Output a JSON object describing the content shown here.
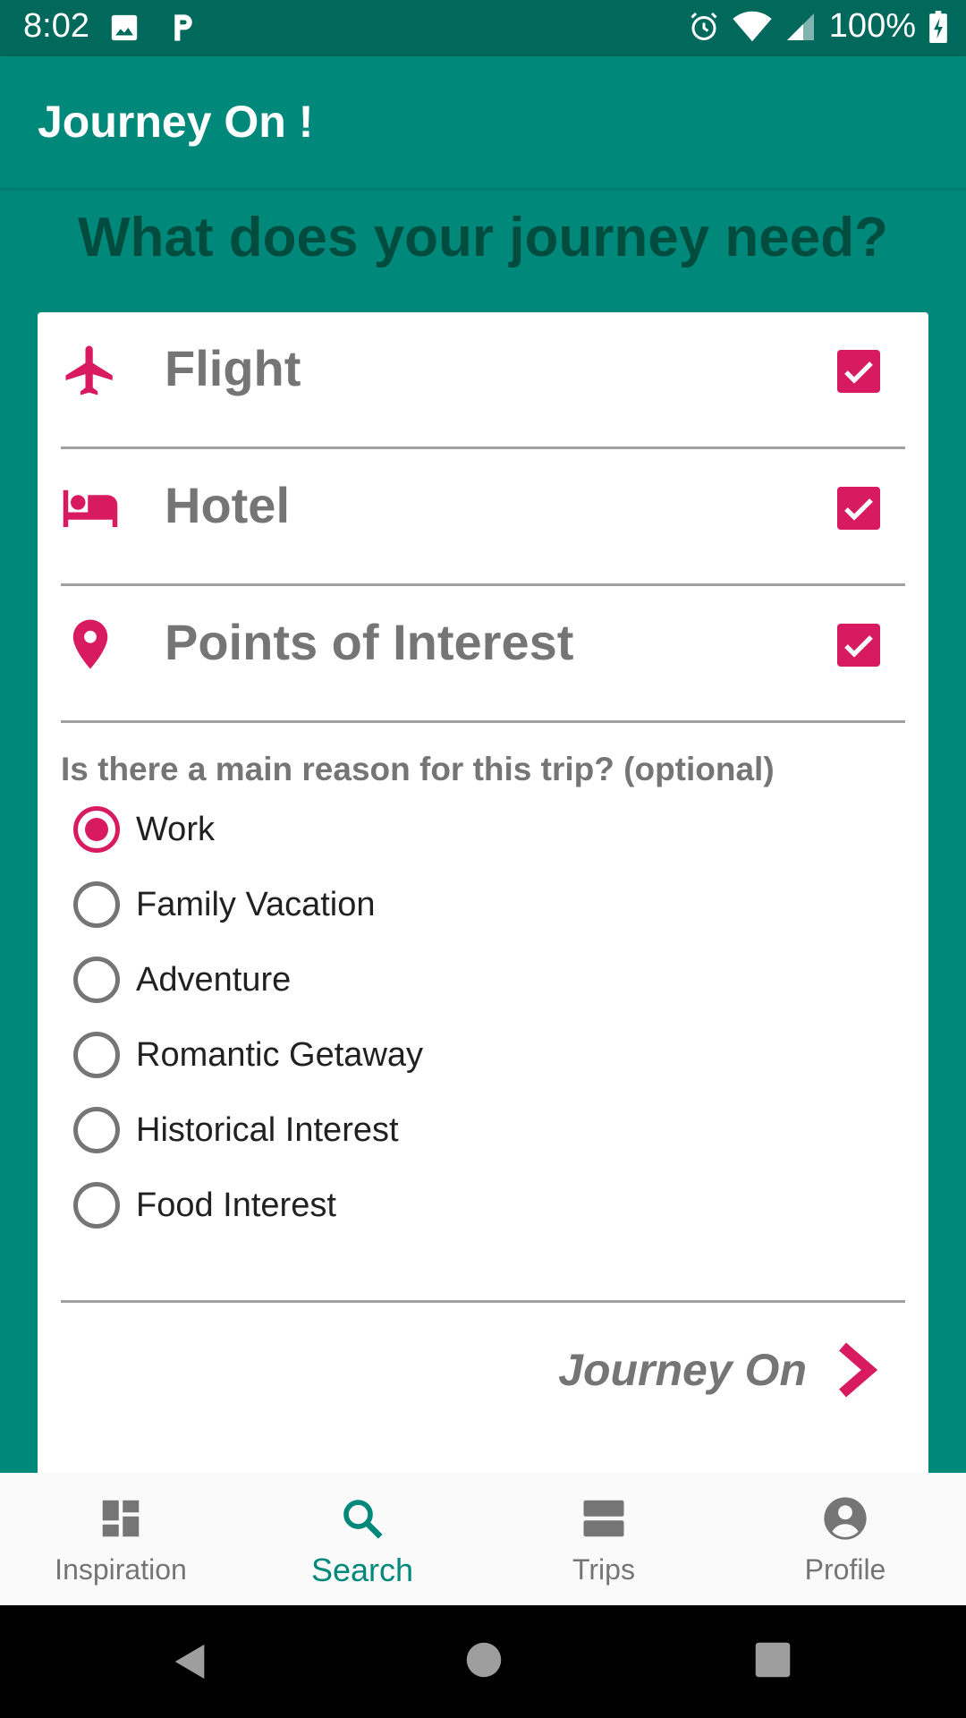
{
  "status_bar": {
    "time": "8:02",
    "battery": "100%"
  },
  "app_bar": {
    "title": "Journey On !"
  },
  "headline": "What does your journey need?",
  "services": [
    {
      "label": "Flight",
      "icon": "airplane-icon",
      "checked": true
    },
    {
      "label": "Hotel",
      "icon": "bed-icon",
      "checked": true
    },
    {
      "label": "Points of Interest",
      "icon": "map-pin-icon",
      "checked": true
    }
  ],
  "question": "Is there a main reason for this trip? (optional)",
  "reasons": [
    {
      "label": "Work",
      "selected": true
    },
    {
      "label": "Family Vacation",
      "selected": false
    },
    {
      "label": "Adventure",
      "selected": false
    },
    {
      "label": "Romantic Getaway",
      "selected": false
    },
    {
      "label": "Historical Interest",
      "selected": false
    },
    {
      "label": "Food Interest",
      "selected": false
    }
  ],
  "submit": {
    "label": "Journey On"
  },
  "bottom_nav": {
    "items": [
      {
        "label": "Inspiration",
        "icon": "dashboard-icon",
        "active": false
      },
      {
        "label": "Search",
        "icon": "search-icon",
        "active": true
      },
      {
        "label": "Trips",
        "icon": "trips-icon",
        "active": false
      },
      {
        "label": "Profile",
        "icon": "profile-icon",
        "active": false
      }
    ]
  },
  "colors": {
    "primary": "#00897b",
    "primary_dark": "#00695c",
    "accent": "#d81b60",
    "headline": "#004d40"
  }
}
